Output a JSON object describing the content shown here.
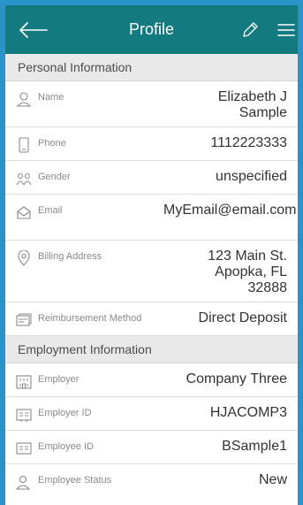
{
  "header": {
    "title": "Profile"
  },
  "sections": {
    "personal": "Personal Information",
    "employment": "Employment Information"
  },
  "rows": {
    "name": {
      "label": "Name",
      "value": "Elizabeth J Sample"
    },
    "phone": {
      "label": "Phone",
      "value": "1112223333"
    },
    "gender": {
      "label": "Gender",
      "value": "unspecified"
    },
    "email": {
      "label": "Email",
      "value": "MyEmail@email.com"
    },
    "billing": {
      "label": "Billing Address",
      "value": "123 Main St. Apopka, FL 32888"
    },
    "reimb": {
      "label": "Reimbursement Method",
      "value": "Direct Deposit"
    },
    "employer": {
      "label": "Employer",
      "value": "Company Three"
    },
    "employer_id": {
      "label": "Employer ID",
      "value": "HJACOMP3"
    },
    "employee_id": {
      "label": "Employee ID",
      "value": "BSample1"
    },
    "status": {
      "label": "Employee Status",
      "value": "New"
    }
  },
  "colors": {
    "header": "#137a80",
    "frame": "#2a93c9",
    "section_bg": "#e9e9ea"
  },
  "icons": {
    "back": "arrow-left-icon",
    "edit": "pencil-icon",
    "menu": "hamburger-icon"
  }
}
